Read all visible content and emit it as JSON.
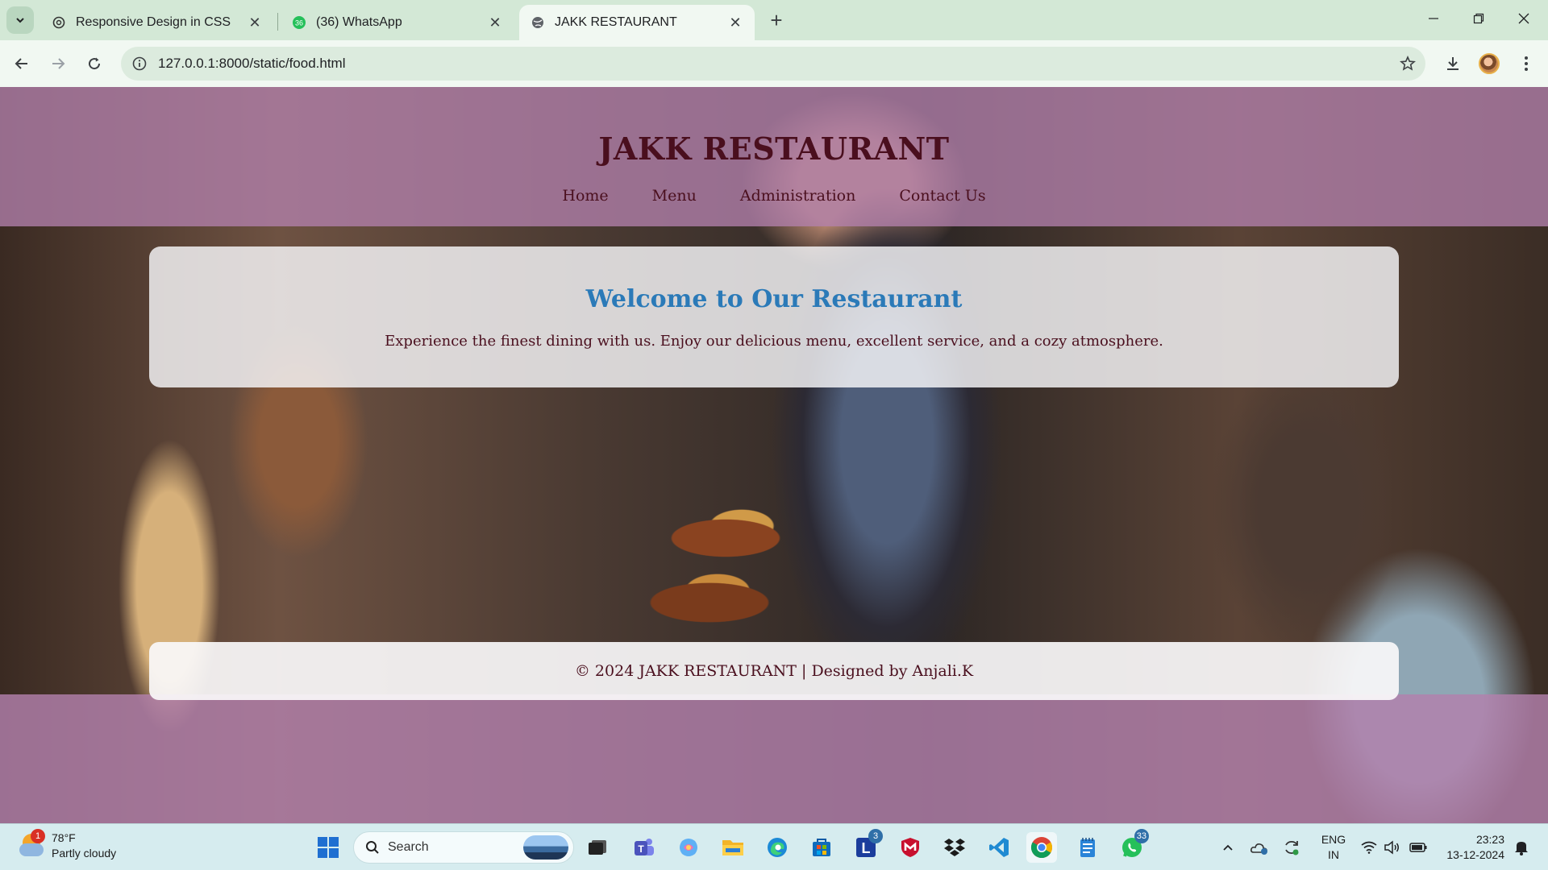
{
  "browser": {
    "tabs": [
      {
        "title": "Responsive Design in CSS"
      },
      {
        "title": "(36) WhatsApp",
        "badge": "36"
      },
      {
        "title": "JAKK RESTAURANT"
      }
    ],
    "url": "127.0.0.1:8000/static/food.html"
  },
  "site": {
    "title": "JAKK RESTAURANT",
    "nav": [
      "Home",
      "Menu",
      "Administration",
      "Contact Us"
    ],
    "welcome_heading": "Welcome to Our Restaurant",
    "welcome_text": "Experience the finest dining with us. Enjoy our delicious menu, excellent service, and a cozy atmosphere.",
    "footer": "© 2024 JAKK RESTAURANT | Designed by Anjali.K",
    "colors": {
      "header_overlay": "#b280ac",
      "title": "#4a0f1e",
      "heading": "#2b7ab8"
    }
  },
  "taskbar": {
    "weather": {
      "temp": "78°F",
      "desc": "Partly cloudy",
      "badge": "1"
    },
    "search_label": "Search",
    "badges": {
      "l_app": "3",
      "whatsapp": "33"
    },
    "lang_top": "ENG",
    "lang_bottom": "IN",
    "time": "23:23",
    "date": "13-12-2024"
  }
}
